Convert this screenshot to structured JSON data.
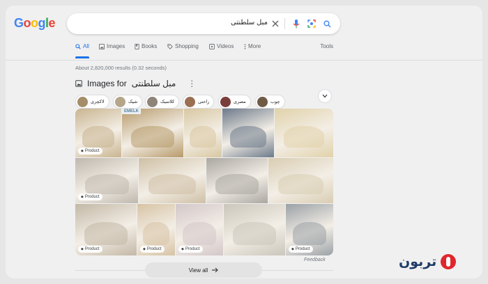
{
  "logo": {
    "letters": [
      {
        "ch": "G",
        "color": "#4285f4"
      },
      {
        "ch": "o",
        "color": "#ea4335"
      },
      {
        "ch": "o",
        "color": "#fbbc05"
      },
      {
        "ch": "g",
        "color": "#4285f4"
      },
      {
        "ch": "l",
        "color": "#34a853"
      },
      {
        "ch": "e",
        "color": "#ea4335"
      }
    ]
  },
  "search": {
    "query": "مبل سلطنتی",
    "icons": [
      "close-icon",
      "microphone-icon",
      "lens-icon",
      "search-icon"
    ]
  },
  "tabs": [
    {
      "label": "All",
      "icon": "search-icon",
      "active": true
    },
    {
      "label": "Images",
      "icon": "image-icon",
      "active": false
    },
    {
      "label": "Books",
      "icon": "book-icon",
      "active": false
    },
    {
      "label": "Shopping",
      "icon": "tag-icon",
      "active": false
    },
    {
      "label": "Videos",
      "icon": "play-icon",
      "active": false
    },
    {
      "label": "More",
      "icon": "more-vertical-icon",
      "active": false
    }
  ],
  "tools_label": "Tools",
  "result_stats": "About 2,820,000 results (0.32 seconds)",
  "images_section": {
    "title_prefix": "Images for",
    "title_query": "مبل سلطنتی",
    "chips": [
      "لاکچری",
      "شیک",
      "کلاسیک",
      "راحتی",
      "مصری",
      "چوب"
    ]
  },
  "image_results": [
    {
      "badge": "Product",
      "color": "#c9b48f"
    },
    {
      "badge": "",
      "watermark": "EMELK",
      "color": "#b79a6a"
    },
    {
      "badge": "",
      "color": "#d8c7a1"
    },
    {
      "badge": "",
      "color": "#6d7a8a"
    },
    {
      "badge": "",
      "color": "#e1d2aa"
    },
    {
      "badge": "Product",
      "color": "#bfb8ae"
    },
    {
      "badge": "",
      "color": "#cfc0a5"
    },
    {
      "badge": "",
      "color": "#a9a7a1"
    },
    {
      "badge": "",
      "color": "#d9cdb2"
    },
    {
      "badge": "Product",
      "color": "#c3b8a6"
    },
    {
      "badge": "Product",
      "color": "#d7c3a4"
    },
    {
      "badge": "Product",
      "color": "#d3c7c9"
    },
    {
      "badge": "",
      "color": "#cbc6bb"
    },
    {
      "badge": "Product",
      "color": "#9ba1a6"
    },
    {
      "badge": "",
      "color": "#d8d4cf"
    },
    {
      "badge": "Product",
      "color": "#cfbfae"
    }
  ],
  "feedback_label": "Feedback",
  "view_all_label": "View all",
  "brand": {
    "name": "تربون",
    "color": "#1f3b66",
    "accent": "#e0262c"
  },
  "accent_color": "#1a73e8"
}
